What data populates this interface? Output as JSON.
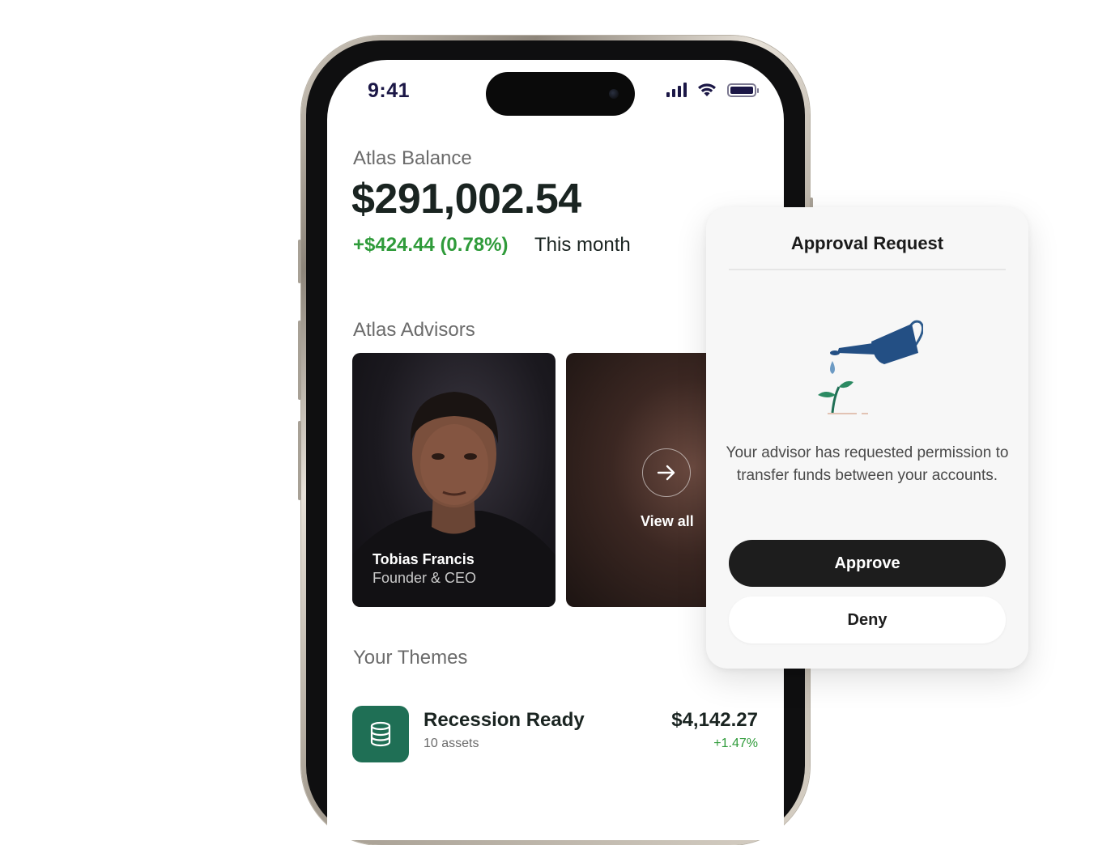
{
  "status_bar": {
    "time": "9:41",
    "icons": [
      "cellular-signal-icon",
      "wifi-icon",
      "battery-icon"
    ]
  },
  "balance": {
    "label": "Atlas Balance",
    "value": "$291,002.54",
    "change": "+$424.44 (0.78%)",
    "period": "This month"
  },
  "advisors": {
    "label": "Atlas Advisors",
    "featured": {
      "name": "Tobias Francis",
      "role": "Founder & CEO"
    },
    "view_all_label": "View all"
  },
  "themes": {
    "label": "Your Themes",
    "items": [
      {
        "name": "Recession Ready",
        "subtitle": "10 assets",
        "value": "$4,142.27",
        "change": "+1.47%",
        "icon": "database-icon"
      }
    ]
  },
  "approval": {
    "title": "Approval Request",
    "message": "Your advisor has requested permission to transfer funds between your accounts.",
    "approve_label": "Approve",
    "deny_label": "Deny",
    "illustration": "watering-can-plant-illustration"
  },
  "colors": {
    "positive": "#2f9b3a",
    "primary_text": "#1a2421",
    "theme_icon_bg": "#1f6f55",
    "approve_bg": "#1d1d1d"
  }
}
